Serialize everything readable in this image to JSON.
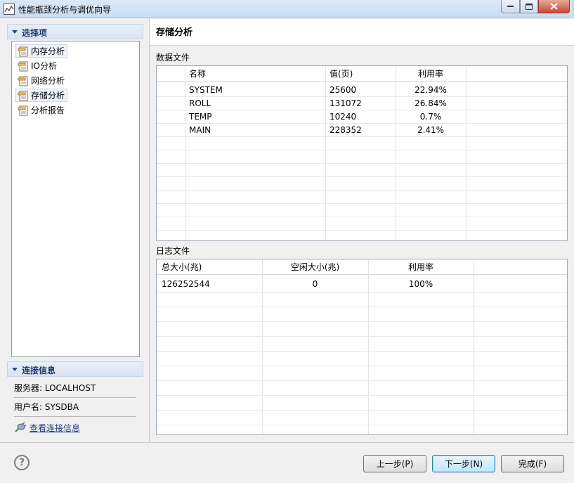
{
  "window": {
    "title": "性能瓶颈分析与调优向导"
  },
  "nav": {
    "header": "选择项",
    "items": [
      {
        "label": "内存分析",
        "selected": true
      },
      {
        "label": "IO分析",
        "selected": false
      },
      {
        "label": "网络分析",
        "selected": false
      },
      {
        "label": "存储分析",
        "selected": true
      },
      {
        "label": "分析报告",
        "selected": false
      }
    ]
  },
  "connection": {
    "header": "连接信息",
    "server": "服务器: LOCALHOST",
    "user": "用户名: SYSDBA",
    "link": "查看连接信息"
  },
  "page": {
    "title": "存储分析"
  },
  "data_files": {
    "label": "数据文件",
    "columns": [
      "名称",
      "值(页)",
      "利用率"
    ],
    "rows": [
      [
        "SYSTEM",
        "25600",
        "22.94%"
      ],
      [
        "ROLL",
        "131072",
        "26.84%"
      ],
      [
        "TEMP",
        "10240",
        "0.7%"
      ],
      [
        "MAIN",
        "228352",
        "2.41%"
      ]
    ]
  },
  "log_files": {
    "label": "日志文件",
    "columns": [
      "总大小(兆)",
      "空闲大小(兆)",
      "利用率"
    ],
    "rows": [
      [
        "126252544",
        "0",
        "100%"
      ]
    ]
  },
  "buttons": {
    "help": "?",
    "prev": "上一步(P)",
    "next": "下一步(N)",
    "finish": "完成(F)"
  },
  "colors": {
    "header_text": "#1e3a6d",
    "link": "#1a3a8a",
    "default_button_border": "#3c7fb1"
  }
}
